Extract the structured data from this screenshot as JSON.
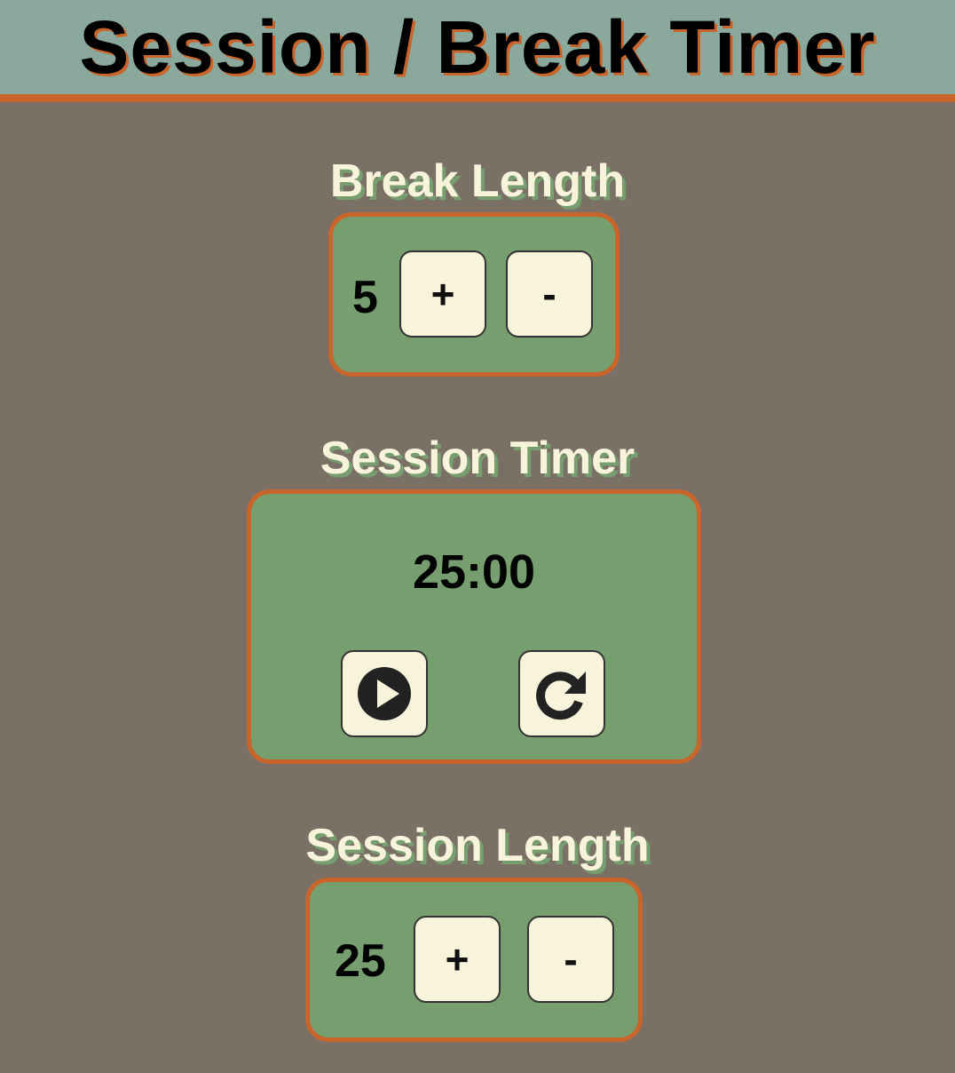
{
  "app": {
    "title": "Session / Break Timer"
  },
  "break": {
    "label": "Break Length",
    "value": "5",
    "increment_label": "+",
    "decrement_label": "-"
  },
  "timer": {
    "label": "Session Timer",
    "display": "25:00",
    "play_icon": "play-circle-icon",
    "reset_icon": "redo-icon"
  },
  "session": {
    "label": "Session Length",
    "value": "25",
    "increment_label": "+",
    "decrement_label": "-"
  },
  "colors": {
    "background": "#7a7066",
    "header": "#8aa89c",
    "accent": "#c9652a",
    "panel": "#769e6e",
    "button": "#f8f4dc"
  }
}
